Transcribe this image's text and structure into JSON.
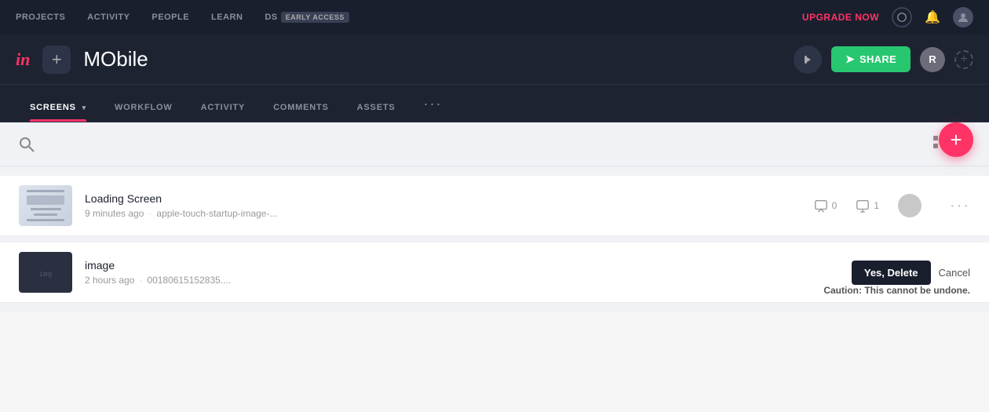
{
  "topNav": {
    "items": [
      "PROJECTS",
      "ACTIVITY",
      "PEOPLE",
      "LEARN",
      "DS"
    ],
    "badge": "EARLY ACCESS",
    "upgradeNow": "UPGRADE NOW"
  },
  "projectBar": {
    "logo": "in",
    "addLabel": "+",
    "title": "MObile",
    "shareLabel": "SHARE",
    "avatarLabel": "R"
  },
  "tabs": {
    "items": [
      "SCREENS",
      "WORKFLOW",
      "ACTIVITY",
      "COMMENTS",
      "ASSETS"
    ],
    "activeIndex": 0,
    "more": "···"
  },
  "fab": "+",
  "toolbar": {
    "gridViewTitle": "Grid view",
    "listViewTitle": "List view"
  },
  "screens": [
    {
      "name": "Loading Screen",
      "time": "9 minutes ago",
      "filename": "apple-touch-startup-image-...",
      "commentCount": "0",
      "screenCount": "1"
    },
    {
      "name": "image",
      "time": "2 hours ago",
      "filename": "00180615152835...."
    }
  ],
  "deleteConfirm": {
    "yesDelete": "Yes, Delete",
    "cancel": "Cancel",
    "caution": "Caution:",
    "cautionMsg": "This cannot be undone."
  }
}
